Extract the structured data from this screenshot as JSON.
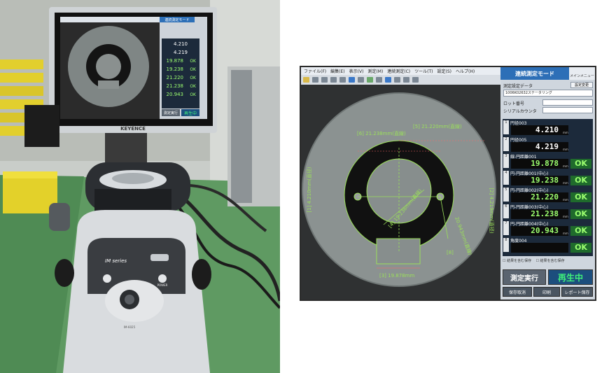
{
  "photo": {
    "brand_label": "KEYENCE",
    "series_label": "IM series",
    "model_label": "IM-6025",
    "power_label": "POWER",
    "mini_screen": {
      "title": "連続測定モード",
      "values": [
        "4.210",
        "4.219",
        "19.878",
        "19.238",
        "21.220",
        "21.238",
        "20.943"
      ],
      "ok": "OK",
      "run": "測定実行",
      "play": "再生中"
    }
  },
  "screen": {
    "menu": [
      "ファイル(F)",
      "編集(E)",
      "表示(V)",
      "測定(M)",
      "連続測定(C)",
      "ツール(T)",
      "設定(S)",
      "ヘルプ(H)"
    ],
    "mode_title": "連続測定モード",
    "main_menu": "メインメニュー",
    "settings_label": "測定設定データ",
    "settings_btn": "設定変更",
    "settings_value": "1006K02632ステータリング",
    "lot_label": "ロット番号",
    "serial_label": "シリアルカウンタ",
    "results": [
      {
        "num": "1",
        "name": "円径003",
        "value": "4.210",
        "unit": "mm",
        "ok": ""
      },
      {
        "num": "2",
        "name": "円径005",
        "value": "4.219",
        "unit": "mm",
        "ok": ""
      },
      {
        "num": "3",
        "name": "線-円距離001",
        "value": "19.878",
        "unit": "mm",
        "ok": "OK"
      },
      {
        "num": "4",
        "name": "円-円距離001(中心)",
        "value": "19.238",
        "unit": "mm",
        "ok": "OK"
      },
      {
        "num": "5",
        "name": "円-円距離002(中心)",
        "value": "21.220",
        "unit": "mm",
        "ok": "OK"
      },
      {
        "num": "6",
        "name": "円-円距離003(中心)",
        "value": "21.238",
        "unit": "mm",
        "ok": "OK"
      },
      {
        "num": "7",
        "name": "円-円距離004(中心)",
        "value": "20.943",
        "unit": "mm",
        "ok": "OK"
      },
      {
        "num": "8",
        "name": "角度004",
        "value": "",
        "unit": "",
        "ok": "OK"
      }
    ],
    "check1": "結果を含む保存",
    "check2": "結果を含む保存",
    "run_button": "測定実行",
    "play_button": "再生中",
    "cancel_save": "保存取消",
    "print": "印刷",
    "report_save": "レポート保存",
    "annotations": {
      "a5": "[5] 21.220mm(直線)",
      "a6": "[6] 21.238mm(直線)",
      "a1": "[1] 4.210mm(直径)",
      "a2": "[2] 4.219mm(直径)",
      "a3": "[3] 19.878mm",
      "a4": "[4] 19.238mm(直線)",
      "a7": "20.943mm(直線)",
      "a8": "[8]"
    },
    "colors": {
      "accent_green": "#7cff5c",
      "mode_blue": "#2d6fb7",
      "ok_bg": "#1f6b2c"
    }
  }
}
